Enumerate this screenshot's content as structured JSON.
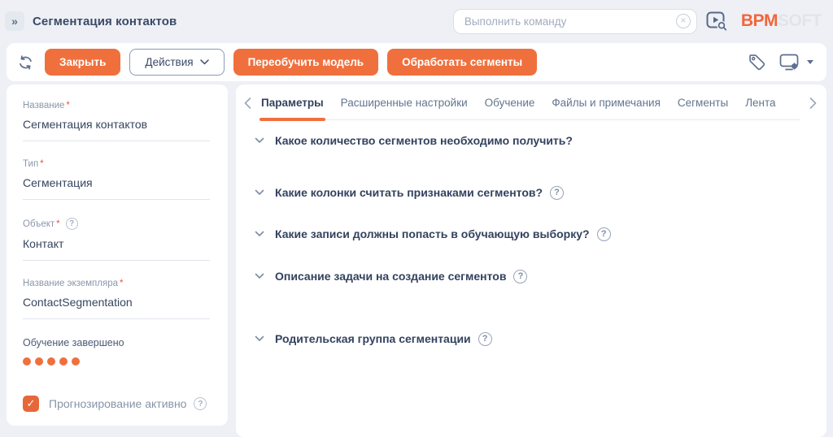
{
  "header": {
    "title": "Сегментация контактов",
    "command_placeholder": "Выполнить команду",
    "logo": {
      "bpm": "BPM",
      "soft": "SOFT"
    }
  },
  "icons": {
    "collapse": "»",
    "clear": "×",
    "check": "✓",
    "question": "?",
    "required_mark": "*"
  },
  "toolbar": {
    "close_label": "Закрыть",
    "actions_label": "Действия",
    "retrain_label": "Переобучить модель",
    "process_label": "Обработать сегменты"
  },
  "sidebar": {
    "fields": [
      {
        "label": "Название",
        "value": "Сегментация контактов",
        "required": true,
        "help": false
      },
      {
        "label": "Тип",
        "value": "Сегментация",
        "required": true,
        "help": false
      },
      {
        "label": "Объект",
        "value": "Контакт",
        "required": true,
        "help": true
      },
      {
        "label": "Название экземпляра",
        "value": "ContactSegmentation",
        "required": true,
        "help": false
      }
    ],
    "training": {
      "label": "Обучение завершено",
      "dots": 5
    },
    "prediction": {
      "label": "Прогнозирование активно",
      "checked": true,
      "help": true
    }
  },
  "tabs": [
    {
      "label": "Параметры",
      "active": true
    },
    {
      "label": "Расширенные настройки",
      "active": false
    },
    {
      "label": "Обучение",
      "active": false
    },
    {
      "label": "Файлы и примечания",
      "active": false
    },
    {
      "label": "Сегменты",
      "active": false
    },
    {
      "label": "Лента",
      "active": false
    }
  ],
  "sections": [
    {
      "label": "Какое количество сегментов необходимо получить?",
      "help": false
    },
    {
      "label": "Какие колонки считать признаками сегментов?",
      "help": true
    },
    {
      "label": "Какие записи должны попасть в обучающую выборку?",
      "help": true
    },
    {
      "label": "Описание задачи на создание сегментов",
      "help": true
    },
    {
      "label": "Родительская группа сегментации",
      "help": true
    }
  ],
  "colors": {
    "accent": "#F0703D",
    "background": "#EEF0F5",
    "text_dark": "#36455F"
  }
}
